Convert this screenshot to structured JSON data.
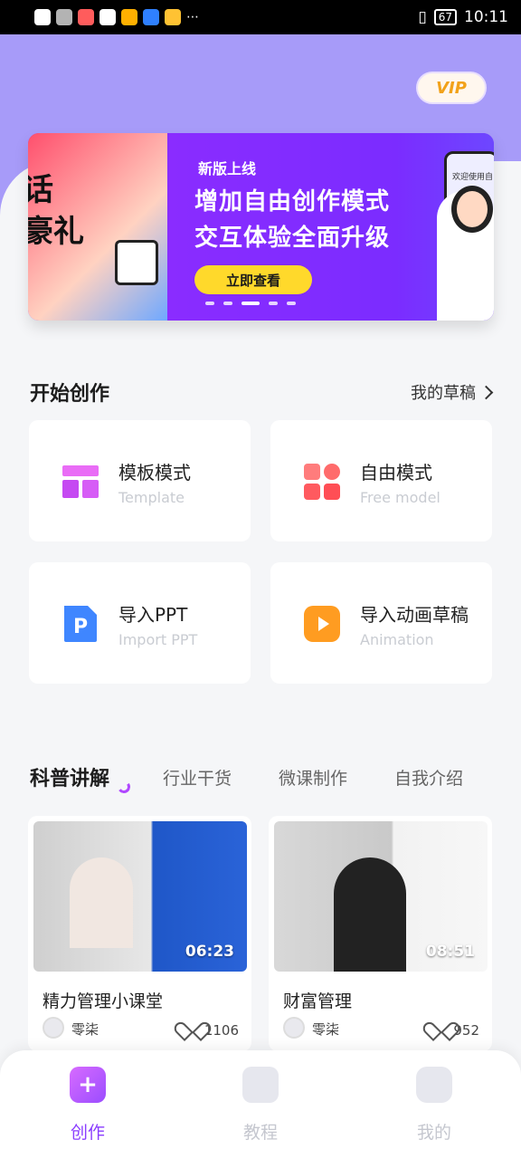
{
  "status_bar": {
    "time": "10:11",
    "battery": "67"
  },
  "vip_label": "VIP",
  "banner": {
    "left_text": "话\n豪礼",
    "tag": "新版上线",
    "line1": "增加自由创作模式",
    "line2": "交互体验全面升级",
    "cta": "立即查看",
    "phone_text": "欢迎使用自"
  },
  "section": {
    "title": "开始创作",
    "drafts": "我的草稿"
  },
  "cards": [
    {
      "title": "模板模式",
      "subtitle": "Template",
      "icon": "template-icon",
      "color": "#d65cf6"
    },
    {
      "title": "自由模式",
      "subtitle": "Free model",
      "icon": "free-mode-icon",
      "color": "#ff5a5f"
    },
    {
      "title": "导入PPT",
      "subtitle": "Import PPT",
      "icon": "ppt-icon",
      "color": "#3f86ff"
    },
    {
      "title": "导入动画草稿",
      "subtitle": "Animation",
      "icon": "animation-icon",
      "color": "#ff9c21"
    }
  ],
  "tabs": [
    "科普讲解",
    "行业干货",
    "微课制作",
    "自我介绍"
  ],
  "videos": [
    {
      "title": "精力管理小课堂",
      "duration": "06:23",
      "author": "零柒",
      "likes": "1106"
    },
    {
      "title": "财富管理",
      "duration": "08:51",
      "author": "零柒",
      "likes": "952"
    }
  ],
  "bottom_nav": [
    {
      "label": "创作",
      "icon": "create-icon",
      "active": true
    },
    {
      "label": "教程",
      "icon": "tutorial-icon",
      "active": false
    },
    {
      "label": "我的",
      "icon": "profile-icon",
      "active": false
    }
  ]
}
